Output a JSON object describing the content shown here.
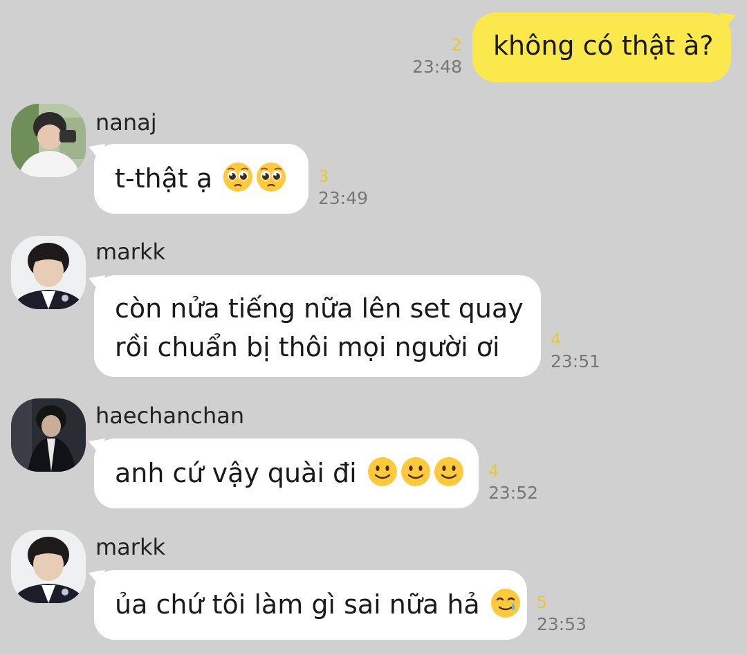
{
  "chat": {
    "messages": [
      {
        "id": "m1",
        "mine": true,
        "text": "không có thật à?",
        "unread": "2",
        "time": "23:48"
      },
      {
        "id": "m2",
        "sender": "nanaj",
        "text": "t-thật ạ",
        "emojis": [
          "pleading-face-icon",
          "pleading-face-icon"
        ],
        "unread": "3",
        "time": "23:49"
      },
      {
        "id": "m3",
        "sender": "markk",
        "lines": [
          "còn nửa tiếng nữa lên set quay",
          "rồi chuẩn bị thôi mọi người ơi"
        ],
        "unread": "4",
        "time": "23:51"
      },
      {
        "id": "m4",
        "sender": "haechanchan",
        "text": "anh cứ vậy quài đi",
        "emojis": [
          "slightly-smiling-face-icon",
          "slightly-smiling-face-icon",
          "slightly-smiling-face-icon"
        ],
        "unread": "4",
        "time": "23:52"
      },
      {
        "id": "m5",
        "sender": "markk",
        "text": "ủa chứ tôi làm gì sai nữa hả",
        "emojis": [
          "smiling-face-with-tear-icon"
        ],
        "unread": "5",
        "time": "23:53"
      }
    ]
  },
  "colors": {
    "background": "#d0d0d0",
    "mine_bubble": "#fae84c",
    "other_bubble": "#ffffff",
    "unread_count": "#e6c92e",
    "time": "#777777"
  }
}
